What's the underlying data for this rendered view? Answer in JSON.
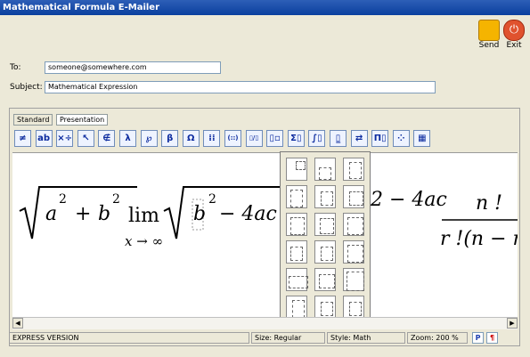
{
  "window": {
    "title": "Mathematical Formula E-Mailer"
  },
  "actions": {
    "send_label": "Send",
    "exit_label": "Exit"
  },
  "form": {
    "to_label": "To:",
    "to_value": "someone@somewhere.com",
    "subject_label": "Subject:",
    "subject_value": "Mathematical Expression"
  },
  "tabs": [
    {
      "label": "Standard"
    },
    {
      "label": "Presentation"
    }
  ],
  "toolbar": {
    "buttons": [
      "≠",
      "ab",
      "×÷",
      "↖",
      "∉",
      "λ",
      "℘",
      "β",
      "Ω",
      "⁞⁞",
      "(::)",
      "▯/▯",
      "▯▫",
      "Σ▯",
      "∫▯",
      "▯̲",
      "⇄",
      "Π▯",
      "⁘",
      "▦"
    ]
  },
  "formula": {
    "t_a": "a",
    "t_2a": "2",
    "t_plus": "+",
    "t_b": "b",
    "t_2b": "2",
    "t_lim": "lim",
    "t_limsub": "x → ∞",
    "t_b2": "b",
    "t_2c": "2",
    "t_minus": "− 4ac",
    "t_right": "2 − 4ac",
    "t_num": "n !",
    "t_den": "r !(n − r)"
  },
  "status": {
    "version": "EXPRESS VERSION",
    "size": "Size: Regular",
    "style": "Style: Math",
    "zoom": "Zoom: 200 %",
    "p_icon": "P",
    "para_icon": "¶"
  },
  "colors": {
    "title_bar": "#0a3f9e",
    "send_icon": "#f5b400",
    "exit_icon": "#e0522e"
  }
}
